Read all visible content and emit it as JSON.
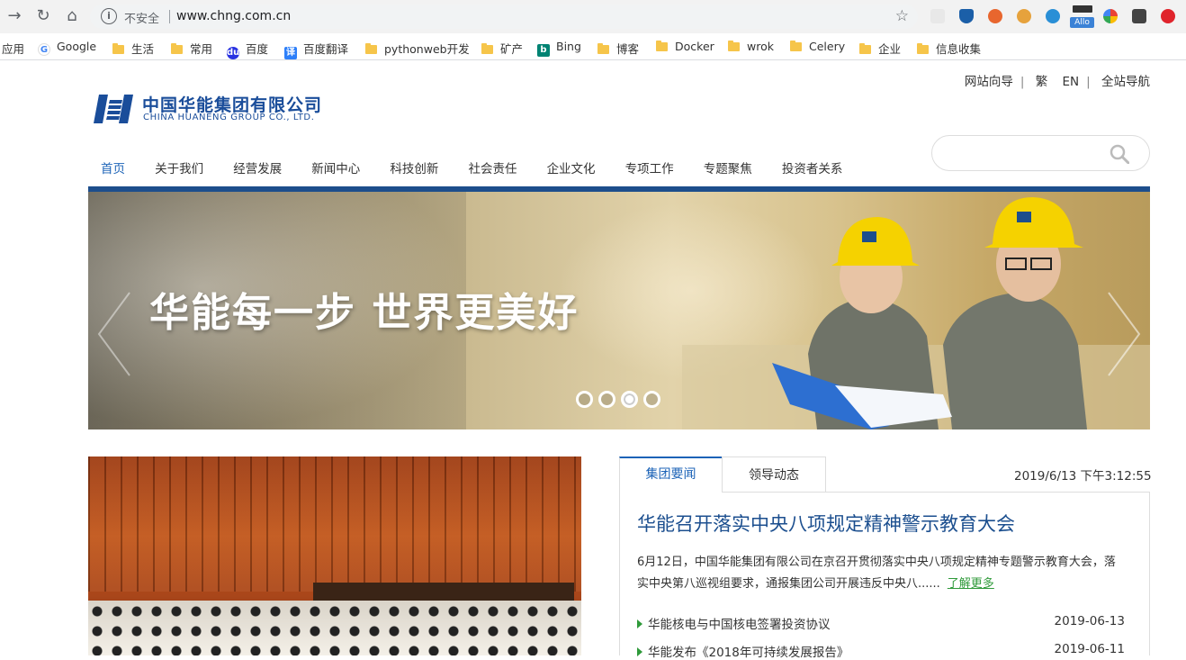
{
  "browser": {
    "url": "www.chng.com.cn",
    "security_label": "不安全",
    "bookmarks": [
      {
        "label": "应用",
        "icon": "apps-icon"
      },
      {
        "label": "Google",
        "icon": "google-icon"
      },
      {
        "label": "生活",
        "icon": "folder-icon"
      },
      {
        "label": "常用",
        "icon": "folder-icon"
      },
      {
        "label": "百度",
        "icon": "baidu-icon"
      },
      {
        "label": "百度翻译",
        "icon": "translate-icon"
      },
      {
        "label": "pythonweb开发",
        "icon": "folder-icon"
      },
      {
        "label": "矿产",
        "icon": "folder-icon"
      },
      {
        "label": "Bing",
        "icon": "bing-icon"
      },
      {
        "label": "博客",
        "icon": "folder-icon"
      },
      {
        "label": "Docker",
        "icon": "folder-icon"
      },
      {
        "label": "wrok",
        "icon": "folder-icon"
      },
      {
        "label": "Celery",
        "icon": "folder-icon"
      },
      {
        "label": "企业",
        "icon": "folder-icon"
      },
      {
        "label": "信息收集",
        "icon": "folder-icon"
      }
    ],
    "extension_badge": "Allo"
  },
  "header": {
    "top_links": [
      "网站向导",
      "繁",
      "EN",
      "全站导航"
    ],
    "logo_cn": "中国华能集团有限公司",
    "logo_en": "CHINA HUANENG GROUP CO., LTD."
  },
  "nav": {
    "items": [
      "首页",
      "关于我们",
      "经营发展",
      "新闻中心",
      "科技创新",
      "社会责任",
      "企业文化",
      "专项工作",
      "专题聚焦",
      "投资者关系"
    ],
    "active_index": 0
  },
  "search": {
    "placeholder": ""
  },
  "banner": {
    "slogan": "华能每一步  世界更美好",
    "slide_count": 4,
    "active_slide": 3
  },
  "news": {
    "tabs": [
      "集团要闻",
      "领导动态"
    ],
    "active_tab": 0,
    "clock": "2019/6/13 下午3:12:55",
    "headline": "华能召开落实中央八项规定精神警示教育大会",
    "summary": "6月12日，中国华能集团有限公司在京召开贯彻落实中央八项规定精神专题警示教育大会，落实中央第八巡视组要求，通报集团公司开展违反中央八......",
    "more_label": "了解更多",
    "items": [
      {
        "title": "华能核电与中国核电签署投资协议",
        "date": "2019-06-13"
      },
      {
        "title": "华能发布《2018年可持续发展报告》",
        "date": "2019-06-11"
      }
    ]
  },
  "colors": {
    "brand_blue": "#1d4e8c",
    "link_blue": "#1c63b7",
    "accent_green": "#2f9a3a"
  }
}
